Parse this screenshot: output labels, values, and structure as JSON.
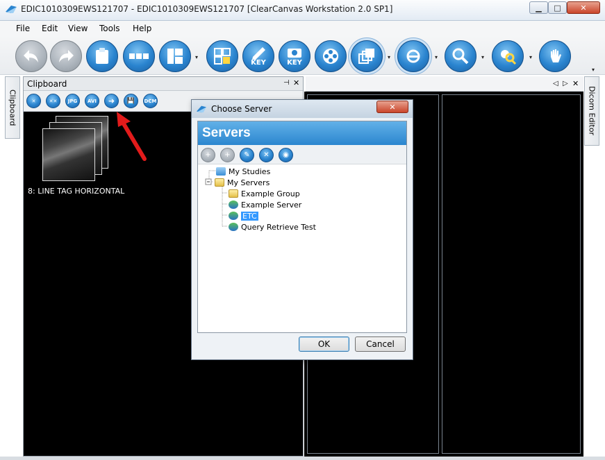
{
  "window": {
    "title": "EDIC1010309EWS121707 - EDIC1010309EWS121707 [ClearCanvas Workstation 2.0 SP1]",
    "minimize": "▁",
    "maximize": "□",
    "close": "✕"
  },
  "menu": [
    "File",
    "Edit",
    "View",
    "Tools",
    "Help"
  ],
  "toolbar": {
    "key_label": "KEY",
    "key_label2": "KEY",
    "dropdown": "▾"
  },
  "side_tabs": {
    "left": "Clipboard",
    "right": "Dicom Editor"
  },
  "clipboard": {
    "title": "Clipboard",
    "pin": "⊣",
    "close": "✕",
    "tools": [
      "✕",
      "✕✕",
      "JPG",
      "AVI",
      "➜",
      "💾",
      "DCM"
    ],
    "thumbnail_label": "8: LINE TAG HORIZONTAL"
  },
  "viewer": {
    "nav_left": "◁",
    "nav_right": "▷",
    "close": "✕"
  },
  "dialog": {
    "title": "Choose Server",
    "close": "✕",
    "header": "Servers",
    "tools": [
      "+",
      "+",
      "✎",
      "✕",
      "◉"
    ],
    "tree": {
      "my_studies": "My Studies",
      "my_servers": "My Servers",
      "children": [
        "Example Group",
        "Example Server",
        "ETC",
        "Query Retrieve Test"
      ]
    },
    "ok": "OK",
    "cancel": "Cancel"
  },
  "colors": {
    "accent_blue": "#2a84cf",
    "selection": "#3399ff",
    "arrow_red": "#e21b1b"
  }
}
